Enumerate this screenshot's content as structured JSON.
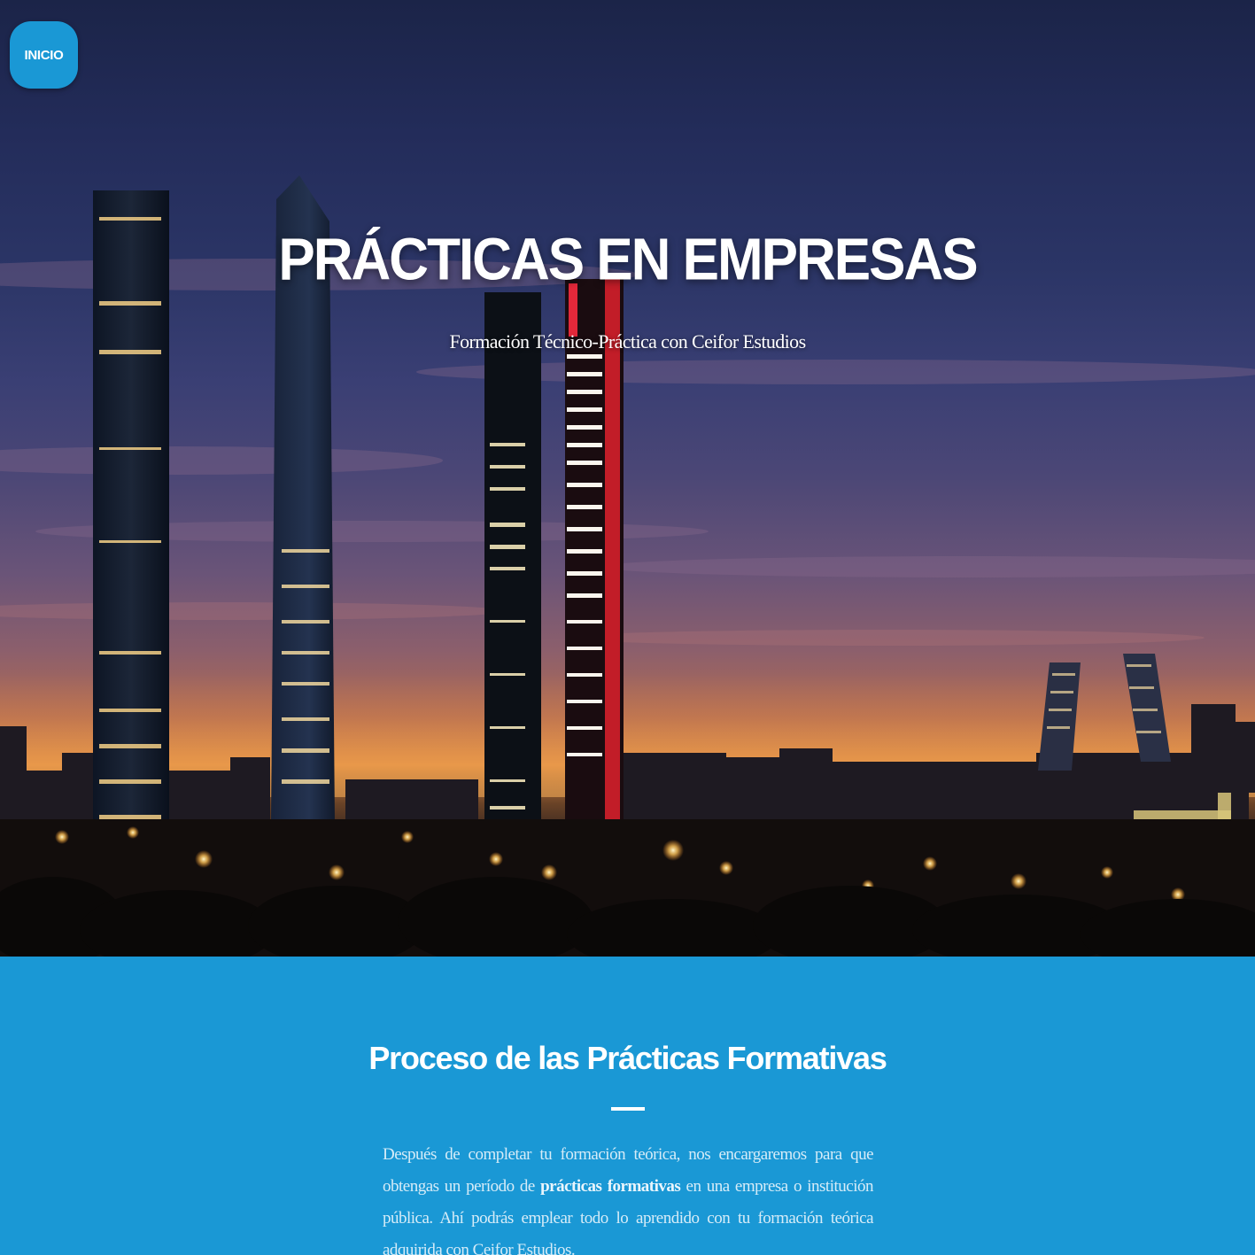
{
  "nav": {
    "home_label": "INICIO"
  },
  "hero": {
    "title": "PRÁCTICAS EN EMPRESAS",
    "subtitle": "Formación Técnico-Práctica con Ceifor Estudios"
  },
  "info": {
    "title": "Proceso de las Prácticas Formativas",
    "body_before": "Después de completar tu formación teórica, nos encargaremos para que obtengas un período de ",
    "body_highlight": "prácticas formativas",
    "body_after": " en una empresa o institución pública. Ahí podrás emplear todo lo aprendido con tu formación teórica adquirida con Ceifor Estudios."
  },
  "colors": {
    "accent": "#1a98d5",
    "text": "#ffffff"
  }
}
